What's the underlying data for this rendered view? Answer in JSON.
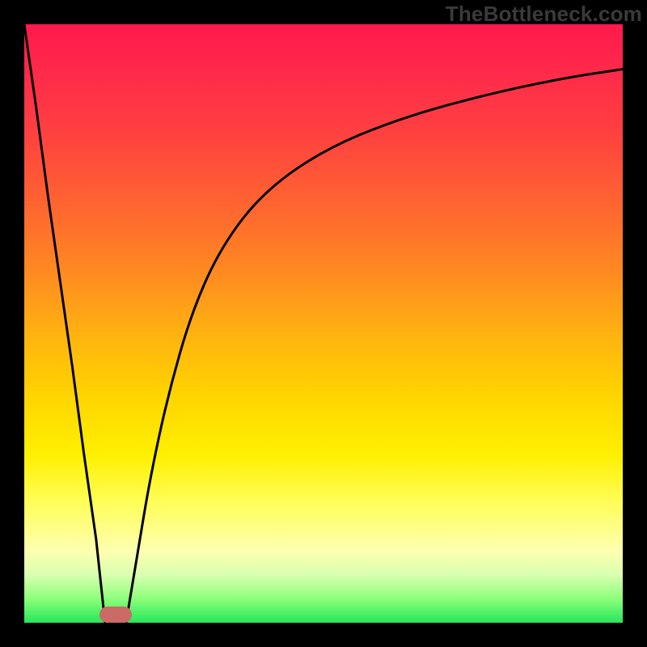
{
  "watermark_text": "TheBottleneck.com",
  "colors": {
    "background": "#000000",
    "curve_stroke": "#000000",
    "marker_fill": "#cc6a66",
    "gradient_top": "#ff1a4d",
    "gradient_mid": "#fff000",
    "gradient_bottom": "#26e65c"
  },
  "chart_data": {
    "type": "line",
    "title": "",
    "xlabel": "",
    "ylabel": "",
    "xlim": [
      0,
      100
    ],
    "ylim": [
      0,
      100
    ],
    "grid": false,
    "series": [
      {
        "name": "left-branch",
        "x": [
          0,
          2,
          4,
          6,
          8,
          10,
          12,
          13.5
        ],
        "values": [
          100,
          86,
          71,
          57,
          43,
          28,
          14,
          0
        ]
      },
      {
        "name": "right-branch",
        "x": [
          17,
          19,
          21,
          24,
          28,
          33,
          40,
          50,
          62,
          76,
          90,
          100
        ],
        "values": [
          0,
          12,
          24,
          38,
          52,
          63,
          72,
          79,
          84,
          88,
          91,
          92.5
        ]
      }
    ],
    "annotations": [
      {
        "name": "optimum-marker",
        "x_range": [
          12.5,
          18
        ],
        "y": 0,
        "shape": "rounded-bar"
      }
    ]
  }
}
